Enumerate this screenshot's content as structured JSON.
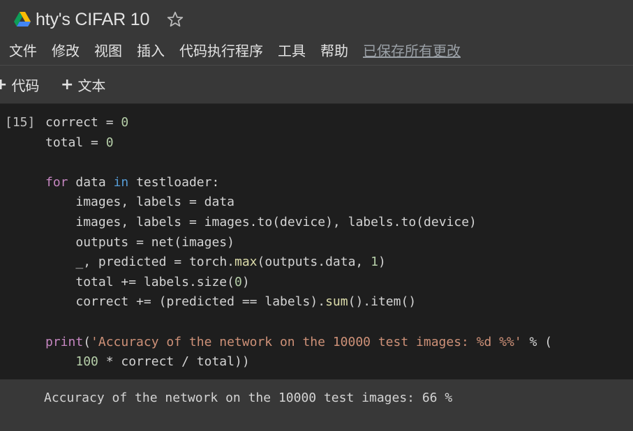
{
  "header": {
    "title": "hty's CIFAR 10",
    "menu": [
      "文件",
      "修改",
      "视图",
      "插入",
      "代码执行程序",
      "工具",
      "帮助"
    ],
    "save_status": "已保存所有更改"
  },
  "toolbar": {
    "add_code_label": "代码",
    "add_text_label": "文本"
  },
  "cell": {
    "execution_count": "[15]",
    "code_lines": [
      "correct = 0",
      "total = 0",
      "",
      "for data in testloader:",
      "    images, labels = data",
      "    images, labels = images.to(device), labels.to(device)",
      "    outputs = net(images)",
      "    _, predicted = torch.max(outputs.data, 1)",
      "    total += labels.size(0)",
      "    correct += (predicted == labels).sum().item()",
      "",
      "print('Accuracy of the network on the 10000 test images: %d %%' % (",
      "    100 * correct / total))"
    ],
    "output": "Accuracy of the network on the 10000 test images: 66 %"
  },
  "colors": {
    "background": "#383838",
    "cell_background": "#1e1e1e",
    "keyword": "#c586c0",
    "number": "#b5cea8",
    "string": "#ce9178",
    "function": "#dcdcaa"
  }
}
